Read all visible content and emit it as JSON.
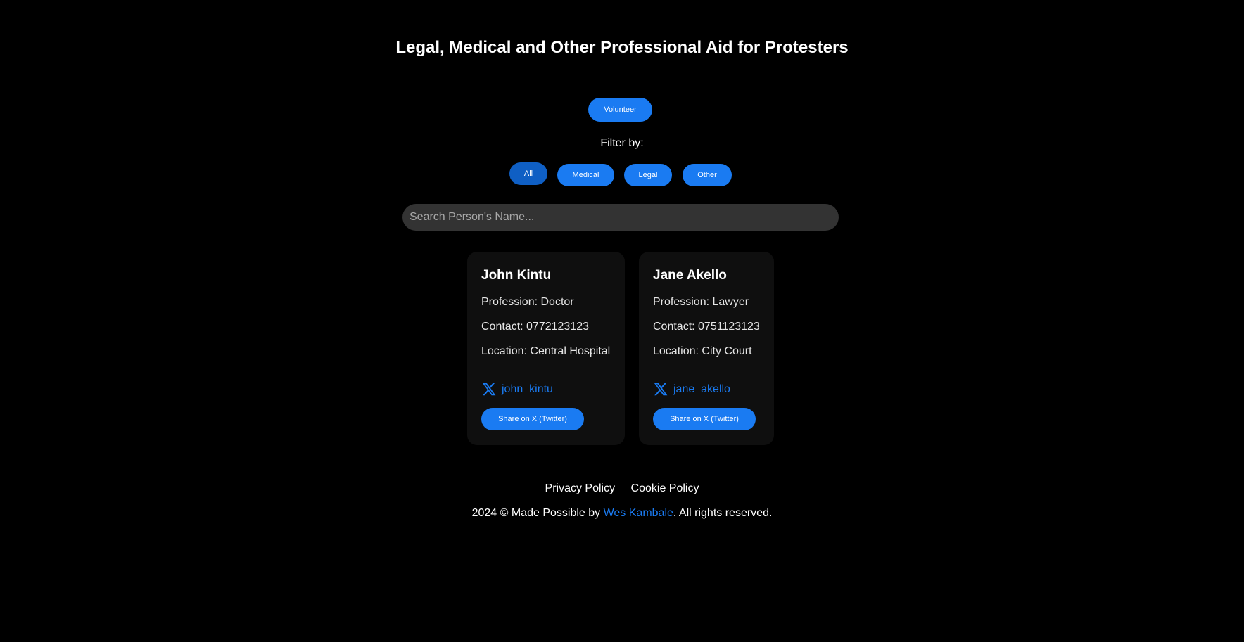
{
  "header": {
    "title": "Legal, Medical and Other Professional Aid for Protesters"
  },
  "actions": {
    "volunteer_label": "Volunteer"
  },
  "filters": {
    "label": "Filter by:",
    "options": [
      "All",
      "Medical",
      "Legal",
      "Other"
    ],
    "selected": "All"
  },
  "search": {
    "placeholder": "Search Person's Name...",
    "value": ""
  },
  "cards": [
    {
      "name": "John Kintu",
      "profession": "Profession: Doctor",
      "contact": "Contact: 0772123123",
      "location": "Location: Central Hospital",
      "twitter_handle": "john_kintu",
      "share_label": "Share on X (Twitter)"
    },
    {
      "name": "Jane Akello",
      "profession": "Profession: Lawyer",
      "contact": "Contact: 0751123123",
      "location": "Location: City Court",
      "twitter_handle": "jane_akello",
      "share_label": "Share on X (Twitter)"
    }
  ],
  "footer": {
    "links": [
      "Privacy Policy",
      "Cookie Policy"
    ],
    "copyright_prefix": "2024 © Made Possible by ",
    "author": "Wes Kambale",
    "copyright_suffix": ". All rights reserved."
  },
  "colors": {
    "background": "#000000",
    "accent": "#1a7bf2",
    "accent_active": "#0f5fc4",
    "card_background": "#0f0f0f",
    "search_background": "#333333"
  },
  "icons": {
    "twitter": "x-logo-icon"
  }
}
